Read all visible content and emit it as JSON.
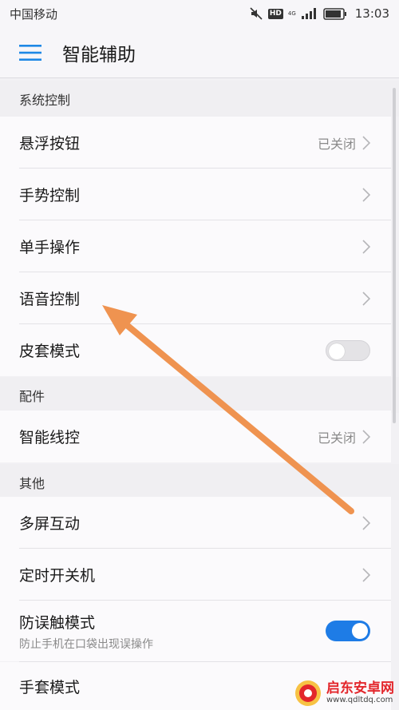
{
  "status_bar": {
    "carrier": "中国移动",
    "hd": "HD",
    "network": "4G",
    "time": "13:03"
  },
  "app_bar": {
    "title": "智能辅助"
  },
  "sections": {
    "system": {
      "header": "系统控制"
    },
    "accessories": {
      "header": "配件"
    },
    "other": {
      "header": "其他"
    }
  },
  "rows": {
    "floating_button": {
      "label": "悬浮按钮",
      "value": "已关闭"
    },
    "gesture_control": {
      "label": "手势控制"
    },
    "one_hand": {
      "label": "单手操作"
    },
    "voice_control": {
      "label": "语音控制"
    },
    "cover_mode": {
      "label": "皮套模式",
      "enabled": false
    },
    "smart_remote": {
      "label": "智能线控",
      "value": "已关闭"
    },
    "multi_screen": {
      "label": "多屏互动"
    },
    "scheduled_power": {
      "label": "定时开关机"
    },
    "accidental_touch": {
      "label": "防误触模式",
      "sub": "防止手机在口袋出现误操作",
      "enabled": true
    },
    "glove_mode": {
      "label": "手套模式"
    }
  },
  "annotation": {
    "arrow_color": "#ef9350"
  },
  "watermark": {
    "name": "启东安卓网",
    "url": "www.qdltdq.com"
  },
  "colors": {
    "accent": "#1e7ce6",
    "menu_icon": "#1e88e5"
  }
}
